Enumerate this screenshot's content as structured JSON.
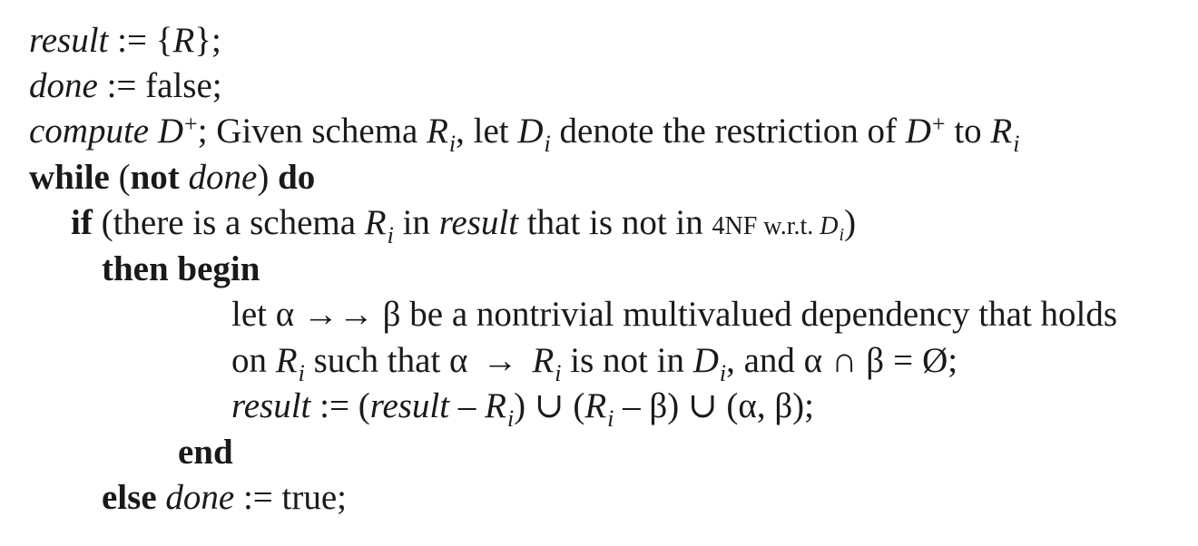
{
  "algorithm": {
    "line1": {
      "var": "result",
      "assign": " := {",
      "rel": "R",
      "end": "};"
    },
    "line2": {
      "var": "done",
      "assign": " := false;"
    },
    "line3": {
      "kw": "compute",
      "d": " D",
      "plus": "+",
      "text1": "; Given schema ",
      "r": "R",
      "i1": "i",
      "text2": ", let ",
      "d2": "D",
      "i2": "i",
      "text3": " denote the restriction of ",
      "d3": "D",
      "plus2": "+",
      "text4": " to ",
      "r2": "R",
      "i3": "i"
    },
    "line4": {
      "kw_while": "while",
      "open": " (",
      "kw_not": "not",
      "done": " done",
      "close": ") ",
      "kw_do": "do"
    },
    "line5": {
      "kw_if": "if",
      "text1": " (there is a schema ",
      "r": "R",
      "i": "i",
      "text2": " in ",
      "result": "result",
      "text3": " that is not in ",
      "nf": "4NF w.r.t. ",
      "d": "D",
      "di": "i",
      "close": ")"
    },
    "line6": {
      "kw": "then begin"
    },
    "line7": {
      "text": "let α →→ β be a nontrivial multivalued dependency that holds"
    },
    "line8": {
      "text1": "on ",
      "r": "R",
      "i": "i",
      "text2": " such that α",
      "arrow": "→",
      "r2": "R",
      "i2": "i",
      "text3": " is not in ",
      "d": "D",
      "di": "i",
      "text4": ", and α",
      "cap": "∩",
      "beta": "β",
      "eq": "=",
      "empty": "Ø;"
    },
    "line9": {
      "result1": "result",
      "assign": " := (",
      "result2": "result",
      "minus": " – ",
      "r": "R",
      "i": "i",
      "text1": ") ∪ (",
      "r2": "R",
      "i2": "i",
      "text2": " – β) ∪ (α, β);"
    },
    "line10": {
      "kw": "end"
    },
    "line11": {
      "kw_else": "else",
      "done": " done",
      "assign": " := true;"
    }
  }
}
